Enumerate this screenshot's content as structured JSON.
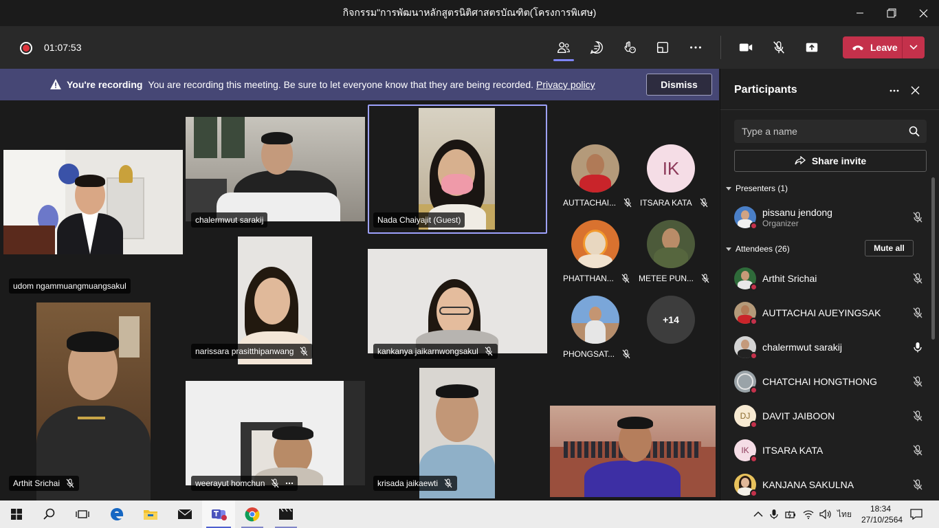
{
  "window": {
    "title": "กิจกรรม\"การพัฒนาหลักสูตรนิติศาสตรบัณฑิต(โครงการพิเศษ)"
  },
  "toolbar": {
    "elapsed": "01:07:53",
    "leave_label": "Leave"
  },
  "banner": {
    "title": "You're recording",
    "message": "You are recording this meeting. Be sure to let everyone know that they are being recorded.",
    "link": "Privacy policy",
    "dismiss_label": "Dismiss"
  },
  "stage": {
    "tiles": [
      {
        "name": "udom ngammuangmuangsakul"
      },
      {
        "name": "chalermwut sarakij"
      },
      {
        "name": "Nada Chaiyajit (Guest)"
      },
      {
        "name": "narissara prasitthipanwang"
      },
      {
        "name": "kankanya jaikarnwongsakul"
      },
      {
        "name": "Arthit Srichai"
      },
      {
        "name": "weerayut homchun"
      },
      {
        "name": "krisada jaikaewti"
      }
    ],
    "roster": [
      {
        "name": "AUTTACHAI...",
        "initials": ""
      },
      {
        "name": "ITSARA KATA",
        "initials": "IK"
      },
      {
        "name": "PHATTHAN...",
        "initials": ""
      },
      {
        "name": "METEE PUN...",
        "initials": ""
      },
      {
        "name": "PHONGSAT...",
        "initials": ""
      }
    ],
    "overflow_label": "+14"
  },
  "panel": {
    "title": "Participants",
    "search_placeholder": "Type a name",
    "share_label": "Share invite",
    "presenters_header": "Presenters (1)",
    "attendees_header": "Attendees (26)",
    "mute_all_label": "Mute all",
    "presenters": [
      {
        "name": "pissanu jendong",
        "role": "Organizer"
      }
    ],
    "attendees": [
      {
        "name": "Arthit Srichai",
        "initials": ""
      },
      {
        "name": "AUTTACHAI AUEYINGSAK",
        "initials": ""
      },
      {
        "name": "chalermwut sarakij",
        "initials": ""
      },
      {
        "name": "CHATCHAI HONGTHONG",
        "initials": ""
      },
      {
        "name": "DAVIT JAIBOON",
        "initials": "DJ"
      },
      {
        "name": "ITSARA KATA",
        "initials": "IK"
      },
      {
        "name": "KANJANA SAKULNA",
        "initials": ""
      }
    ]
  },
  "taskbar": {
    "lang": "ไทย",
    "time": "18:34",
    "date": "27/10/2564"
  },
  "colors": {
    "leave": "#c4314b",
    "banner": "#464775",
    "accent": "#7f85f5"
  }
}
